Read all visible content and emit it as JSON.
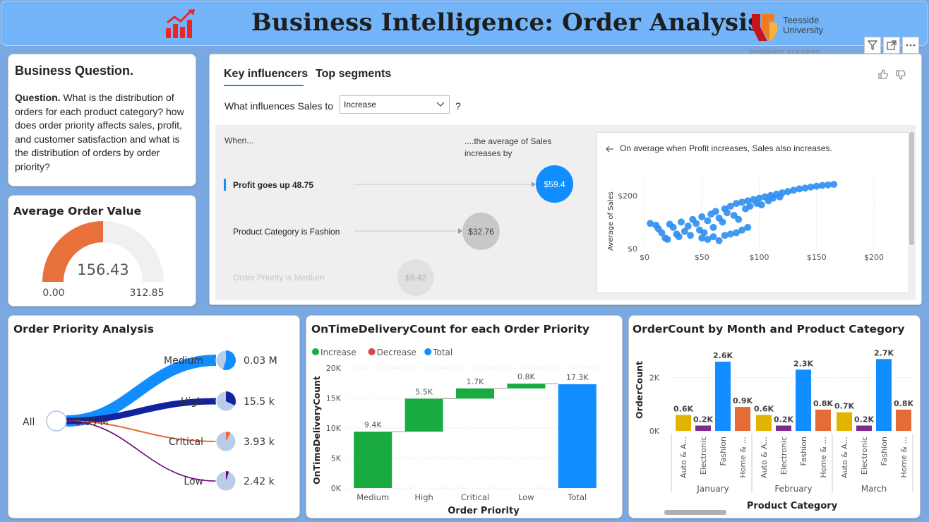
{
  "header": {
    "title": "Business Intelligence: Order Analysis",
    "university_name_line1": "Teesside",
    "university_name_line2": "University",
    "university_tagline": "Inspiring success",
    "logo_icon": "bar-chart-trend-icon",
    "toolbar_icons": [
      "filter-icon",
      "focus-mode-icon",
      "more-options-icon"
    ]
  },
  "business_question": {
    "title": "Business Question.",
    "label": "Question.",
    "text": "What is the distribution of orders for each product category? how does order priority affects sales, profit, and customer satisfaction and what is the distribution of orders by order priority?"
  },
  "average_order_value": {
    "title": "Average Order Value",
    "value": "156.43",
    "min": "0.00",
    "max": "312.85",
    "fill_fraction": 0.5,
    "fill_color": "#e8703a",
    "track_color": "#f0f0f0"
  },
  "key_influencers": {
    "tabs": [
      "Key influencers",
      "Top segments"
    ],
    "active_tab": "Key influencers",
    "question_prefix": "What influences Sales to",
    "dropdown_value": "Increase",
    "question_suffix": "?",
    "col_when": "When...",
    "col_result_line1": "....the average of Sales",
    "col_result_line2": "increases by",
    "influencers": [
      {
        "label": "Profit goes up 48.75",
        "value": "$59.4",
        "selected": true
      },
      {
        "label": "Product Category is Fashion",
        "value": "$32.76",
        "selected": false
      },
      {
        "label": "Order Priority is Medium",
        "value": "$9.42",
        "selected": false
      }
    ],
    "detail": {
      "text": "On average when Profit increases, Sales also increases.",
      "ylabel": "Average of Sales",
      "x_ticks": [
        "$0",
        "$50",
        "$100",
        "$150",
        "$200"
      ],
      "y_ticks": [
        "$0",
        "$200"
      ]
    }
  },
  "order_priority_analysis": {
    "title": "Order Priority Analysis",
    "root_label": "All",
    "root_value": "0.05 M",
    "branches": [
      {
        "name": "Medium",
        "value": "0.03 M",
        "color": "#118dff",
        "fill": 0.55
      },
      {
        "name": "High",
        "value": "15.5 k",
        "color": "#12239e",
        "fill": 0.32
      },
      {
        "name": "Critical",
        "value": "3.93 k",
        "color": "#e66c37",
        "fill": 0.08
      },
      {
        "name": "Low",
        "value": "2.42 k",
        "color": "#6b007b",
        "fill": 0.05
      }
    ]
  },
  "chart_data": [
    {
      "type": "scatter",
      "title": "",
      "xlabel": "",
      "ylabel": "Average of Sales",
      "xlim": [
        0,
        200
      ],
      "ylim": [
        0,
        250
      ],
      "trend": "positive",
      "points": [
        [
          5,
          95
        ],
        [
          10,
          88
        ],
        [
          12,
          75
        ],
        [
          15,
          60
        ],
        [
          18,
          40
        ],
        [
          20,
          35
        ],
        [
          22,
          92
        ],
        [
          25,
          80
        ],
        [
          28,
          55
        ],
        [
          30,
          45
        ],
        [
          32,
          100
        ],
        [
          35,
          65
        ],
        [
          38,
          85
        ],
        [
          40,
          50
        ],
        [
          42,
          110
        ],
        [
          45,
          95
        ],
        [
          48,
          70
        ],
        [
          50,
          120
        ],
        [
          52,
          60
        ],
        [
          55,
          105
        ],
        [
          58,
          130
        ],
        [
          60,
          80
        ],
        [
          62,
          140
        ],
        [
          65,
          115
        ],
        [
          68,
          100
        ],
        [
          70,
          150
        ],
        [
          72,
          135
        ],
        [
          75,
          160
        ],
        [
          78,
          125
        ],
        [
          80,
          170
        ],
        [
          82,
          110
        ],
        [
          85,
          175
        ],
        [
          88,
          150
        ],
        [
          90,
          180
        ],
        [
          92,
          160
        ],
        [
          95,
          185
        ],
        [
          98,
          170
        ],
        [
          100,
          190
        ],
        [
          102,
          165
        ],
        [
          105,
          195
        ],
        [
          108,
          180
        ],
        [
          110,
          200
        ],
        [
          112,
          190
        ],
        [
          115,
          205
        ],
        [
          118,
          195
        ],
        [
          120,
          210
        ],
        [
          125,
          215
        ],
        [
          130,
          220
        ],
        [
          135,
          225
        ],
        [
          140,
          228
        ],
        [
          145,
          232
        ],
        [
          150,
          235
        ],
        [
          155,
          238
        ],
        [
          160,
          240
        ],
        [
          165,
          242
        ],
        [
          50,
          40
        ],
        [
          55,
          35
        ],
        [
          60,
          45
        ],
        [
          65,
          30
        ],
        [
          70,
          50
        ],
        [
          75,
          55
        ],
        [
          80,
          60
        ],
        [
          85,
          70
        ],
        [
          90,
          80
        ]
      ]
    },
    {
      "type": "bar",
      "subtype": "waterfall",
      "title": "OnTimeDeliveryCount for each Order Priority",
      "xlabel": "Order Priority",
      "ylabel": "OnTimeDeliveryCount",
      "ylim": [
        0,
        20000
      ],
      "y_ticks": [
        "0K",
        "5K",
        "10K",
        "15K",
        "20K"
      ],
      "legend": [
        {
          "name": "Increase",
          "color": "#1aab40"
        },
        {
          "name": "Decrease",
          "color": "#d64550"
        },
        {
          "name": "Total",
          "color": "#118dff"
        }
      ],
      "categories": [
        "Medium",
        "High",
        "Critical",
        "Low",
        "Total"
      ],
      "values": [
        9400,
        5500,
        1700,
        800,
        17300
      ],
      "labels": [
        "9.4K",
        "5.5K",
        "1.7K",
        "0.8K",
        "17.3K"
      ],
      "kinds": [
        "Increase",
        "Increase",
        "Increase",
        "Increase",
        "Total"
      ]
    },
    {
      "type": "bar",
      "title": "OrderCount by Month and Product Category",
      "xlabel": "Product Category",
      "ylabel": "OrderCount",
      "ylim": [
        0,
        3000
      ],
      "y_ticks": [
        "0K",
        "2K"
      ],
      "groups": [
        "January",
        "February",
        "March"
      ],
      "categories": [
        "Auto & A...",
        "Electronic",
        "Fashion",
        "Home & ..."
      ],
      "category_colors": [
        "#e0b400",
        "#7b2c8f",
        "#118dff",
        "#e66c37"
      ],
      "values": [
        [
          600,
          200,
          2600,
          900
        ],
        [
          600,
          200,
          2300,
          800
        ],
        [
          700,
          200,
          2700,
          800
        ]
      ],
      "labels": [
        [
          "0.6K",
          "0.2K",
          "2.6K",
          "0.9K"
        ],
        [
          "0.6K",
          "0.2K",
          "2.3K",
          "0.8K"
        ],
        [
          "0.7K",
          "0.2K",
          "2.7K",
          "0.8K"
        ]
      ]
    }
  ]
}
